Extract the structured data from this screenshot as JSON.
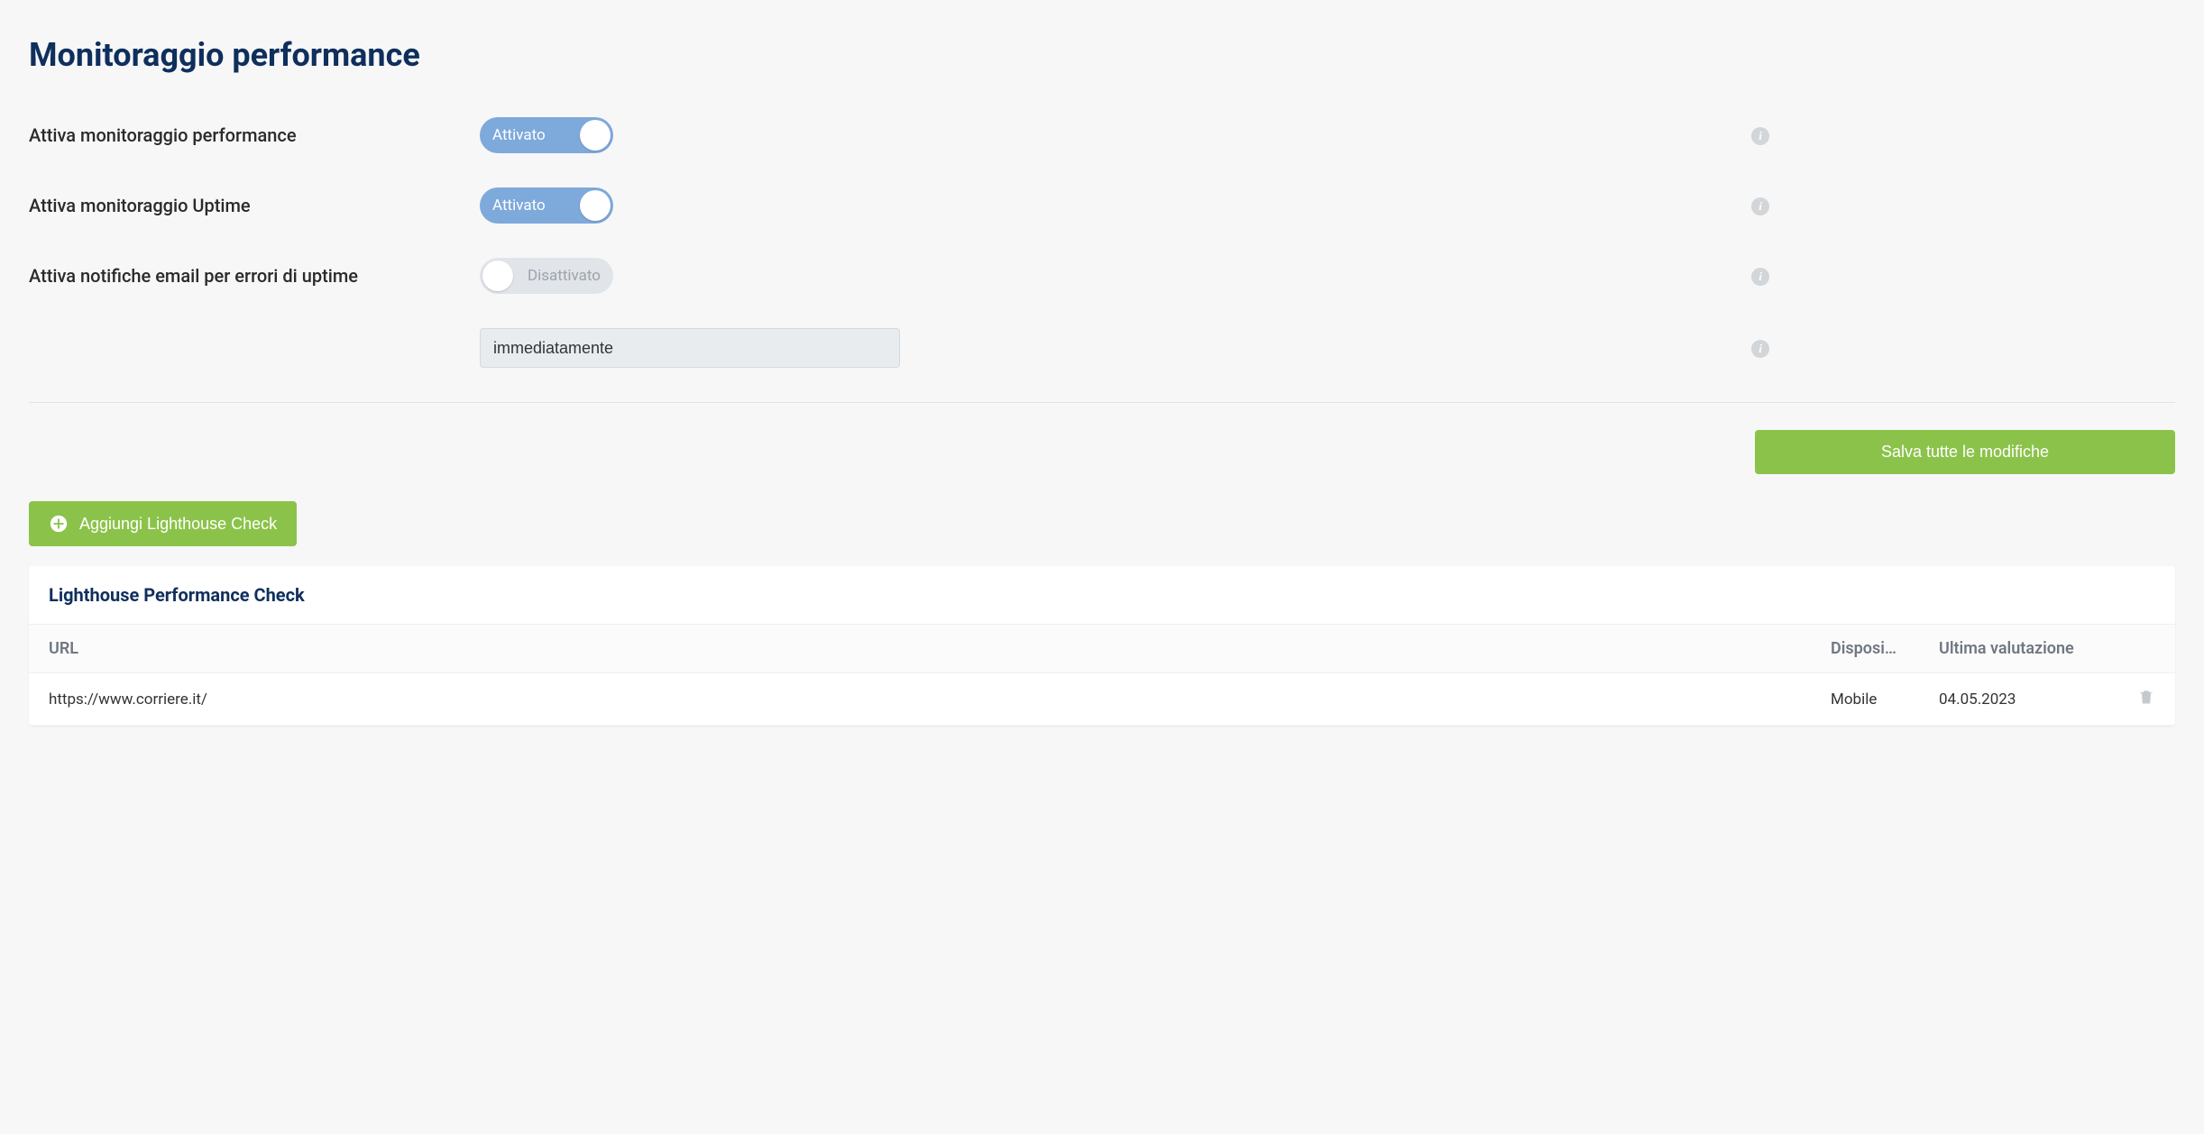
{
  "page": {
    "title": "Monitoraggio performance"
  },
  "settings": {
    "perf_monitoring": {
      "label": "Attiva monitoraggio performance",
      "state_label": "Attivato"
    },
    "uptime_monitoring": {
      "label": "Attiva monitoraggio Uptime",
      "state_label": "Attivato"
    },
    "email_notify": {
      "label": "Attiva notifiche email per errori di uptime",
      "state_label": "Disattivato"
    },
    "frequency": {
      "value": "immediatamente"
    }
  },
  "buttons": {
    "save": "Salva tutte le modifiche",
    "add_lighthouse": "Aggiungi Lighthouse Check"
  },
  "table": {
    "title": "Lighthouse Performance Check",
    "headers": {
      "url": "URL",
      "device": "Dispositi…",
      "last_eval": "Ultima valutazione"
    },
    "rows": [
      {
        "url": "https://www.corriere.it/",
        "device": "Mobile",
        "last_eval": "04.05.2023"
      }
    ]
  }
}
